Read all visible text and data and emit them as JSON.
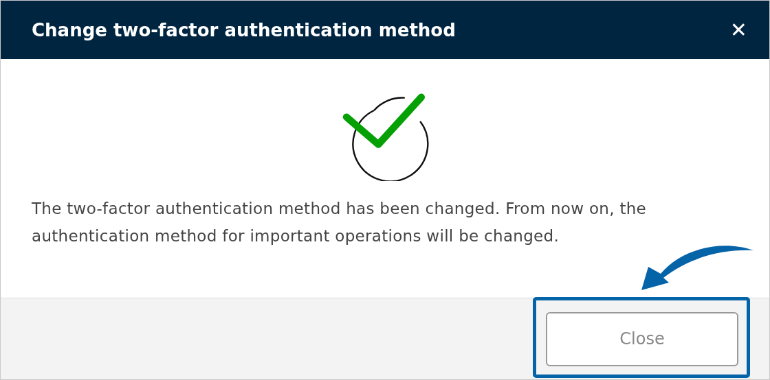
{
  "dialog": {
    "title": "Change two-factor authentication method",
    "close_glyph": "✕",
    "message": "The two-factor authentication method has been changed. From now on, the authentication method for important operations will be changed.",
    "buttons": [
      {
        "label": "Close",
        "kind": "secondary"
      }
    ]
  }
}
